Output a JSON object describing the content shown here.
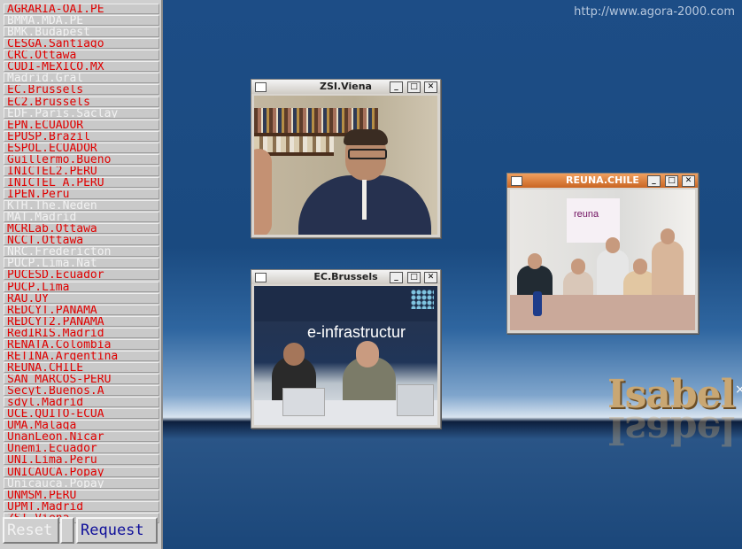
{
  "header": {
    "url": "http://www.agora-2000.com"
  },
  "brand": {
    "text": "Isabel",
    "close_glyph": "×"
  },
  "sites": [
    {
      "label": "AGRARIA-OAI.PE",
      "enabled": true
    },
    {
      "label": "BMMA.MDA.PE",
      "enabled": false
    },
    {
      "label": "BMK.Budapest",
      "enabled": false
    },
    {
      "label": "CESGA.Santiago",
      "enabled": true
    },
    {
      "label": "CRC.Ottawa",
      "enabled": true
    },
    {
      "label": "CUDI-MEXICO.MX",
      "enabled": true
    },
    {
      "label": "Madrid.Gral",
      "enabled": false
    },
    {
      "label": "EC.Brussels",
      "enabled": true
    },
    {
      "label": "EC2.Brussels",
      "enabled": true
    },
    {
      "label": "EDF.Paris.Saclay",
      "enabled": false
    },
    {
      "label": "EPN.ECUADOR",
      "enabled": true
    },
    {
      "label": "EPUSP.Brazil",
      "enabled": true
    },
    {
      "label": "ESPOL.ECUADOR",
      "enabled": true
    },
    {
      "label": "Guillermo.Bueno",
      "enabled": true
    },
    {
      "label": "INICTEL2.PERU",
      "enabled": true
    },
    {
      "label": "INICTEL_A.PERU",
      "enabled": true
    },
    {
      "label": "IPEN.Peru",
      "enabled": true
    },
    {
      "label": "KTH.The.Neden",
      "enabled": false
    },
    {
      "label": "MAT.Madrid",
      "enabled": false
    },
    {
      "label": "MCRLab.Ottawa",
      "enabled": true
    },
    {
      "label": "NCCT.Ottawa",
      "enabled": true
    },
    {
      "label": "NRC.Fredericton",
      "enabled": false
    },
    {
      "label": "PUCP.Lima.Nat",
      "enabled": false
    },
    {
      "label": "PUCESD.Ecuador",
      "enabled": true
    },
    {
      "label": "PUCP.Lima",
      "enabled": true
    },
    {
      "label": "RAU.UY",
      "enabled": true
    },
    {
      "label": "REDCYT.PANAMA",
      "enabled": true
    },
    {
      "label": "REDCYT2.PANAMA",
      "enabled": true
    },
    {
      "label": "RedIRIS.Madrid",
      "enabled": true
    },
    {
      "label": "RENATA.Colombia",
      "enabled": true
    },
    {
      "label": "RETINA.Argentina",
      "enabled": true
    },
    {
      "label": "REUNA.CHILE",
      "enabled": true
    },
    {
      "label": "SAN_MARCOS-PERU",
      "enabled": true
    },
    {
      "label": "Secyt.Buenos.A",
      "enabled": true
    },
    {
      "label": "sdyl.Madrid",
      "enabled": true
    },
    {
      "label": "UCE.QUITO-ECUA",
      "enabled": true
    },
    {
      "label": "UMA.Malaga",
      "enabled": true
    },
    {
      "label": "UnanLeon.Nicar",
      "enabled": true
    },
    {
      "label": "Unemi.Ecuador",
      "enabled": true
    },
    {
      "label": "UNI.Lima.Peru",
      "enabled": true
    },
    {
      "label": "UNICAUCA.Popay",
      "enabled": true
    },
    {
      "label": "Unicauca.Popay",
      "enabled": false
    },
    {
      "label": "UNMSM.PERU",
      "enabled": true
    },
    {
      "label": "UPMT.Madrid",
      "enabled": true
    },
    {
      "label": "ZSI.Viena",
      "enabled": true
    }
  ],
  "buttons": {
    "reset": "Reset",
    "request": "Request"
  },
  "windows": {
    "zsi": {
      "title": "ZSI.Viena"
    },
    "ec": {
      "title": "EC.Brussels",
      "slide": "e-infrastructur"
    },
    "reuna": {
      "title": "REUNA.CHILE",
      "banner": "reuna"
    }
  },
  "window_buttons": {
    "minimize": "_",
    "maximize": "□",
    "close": "✕"
  }
}
